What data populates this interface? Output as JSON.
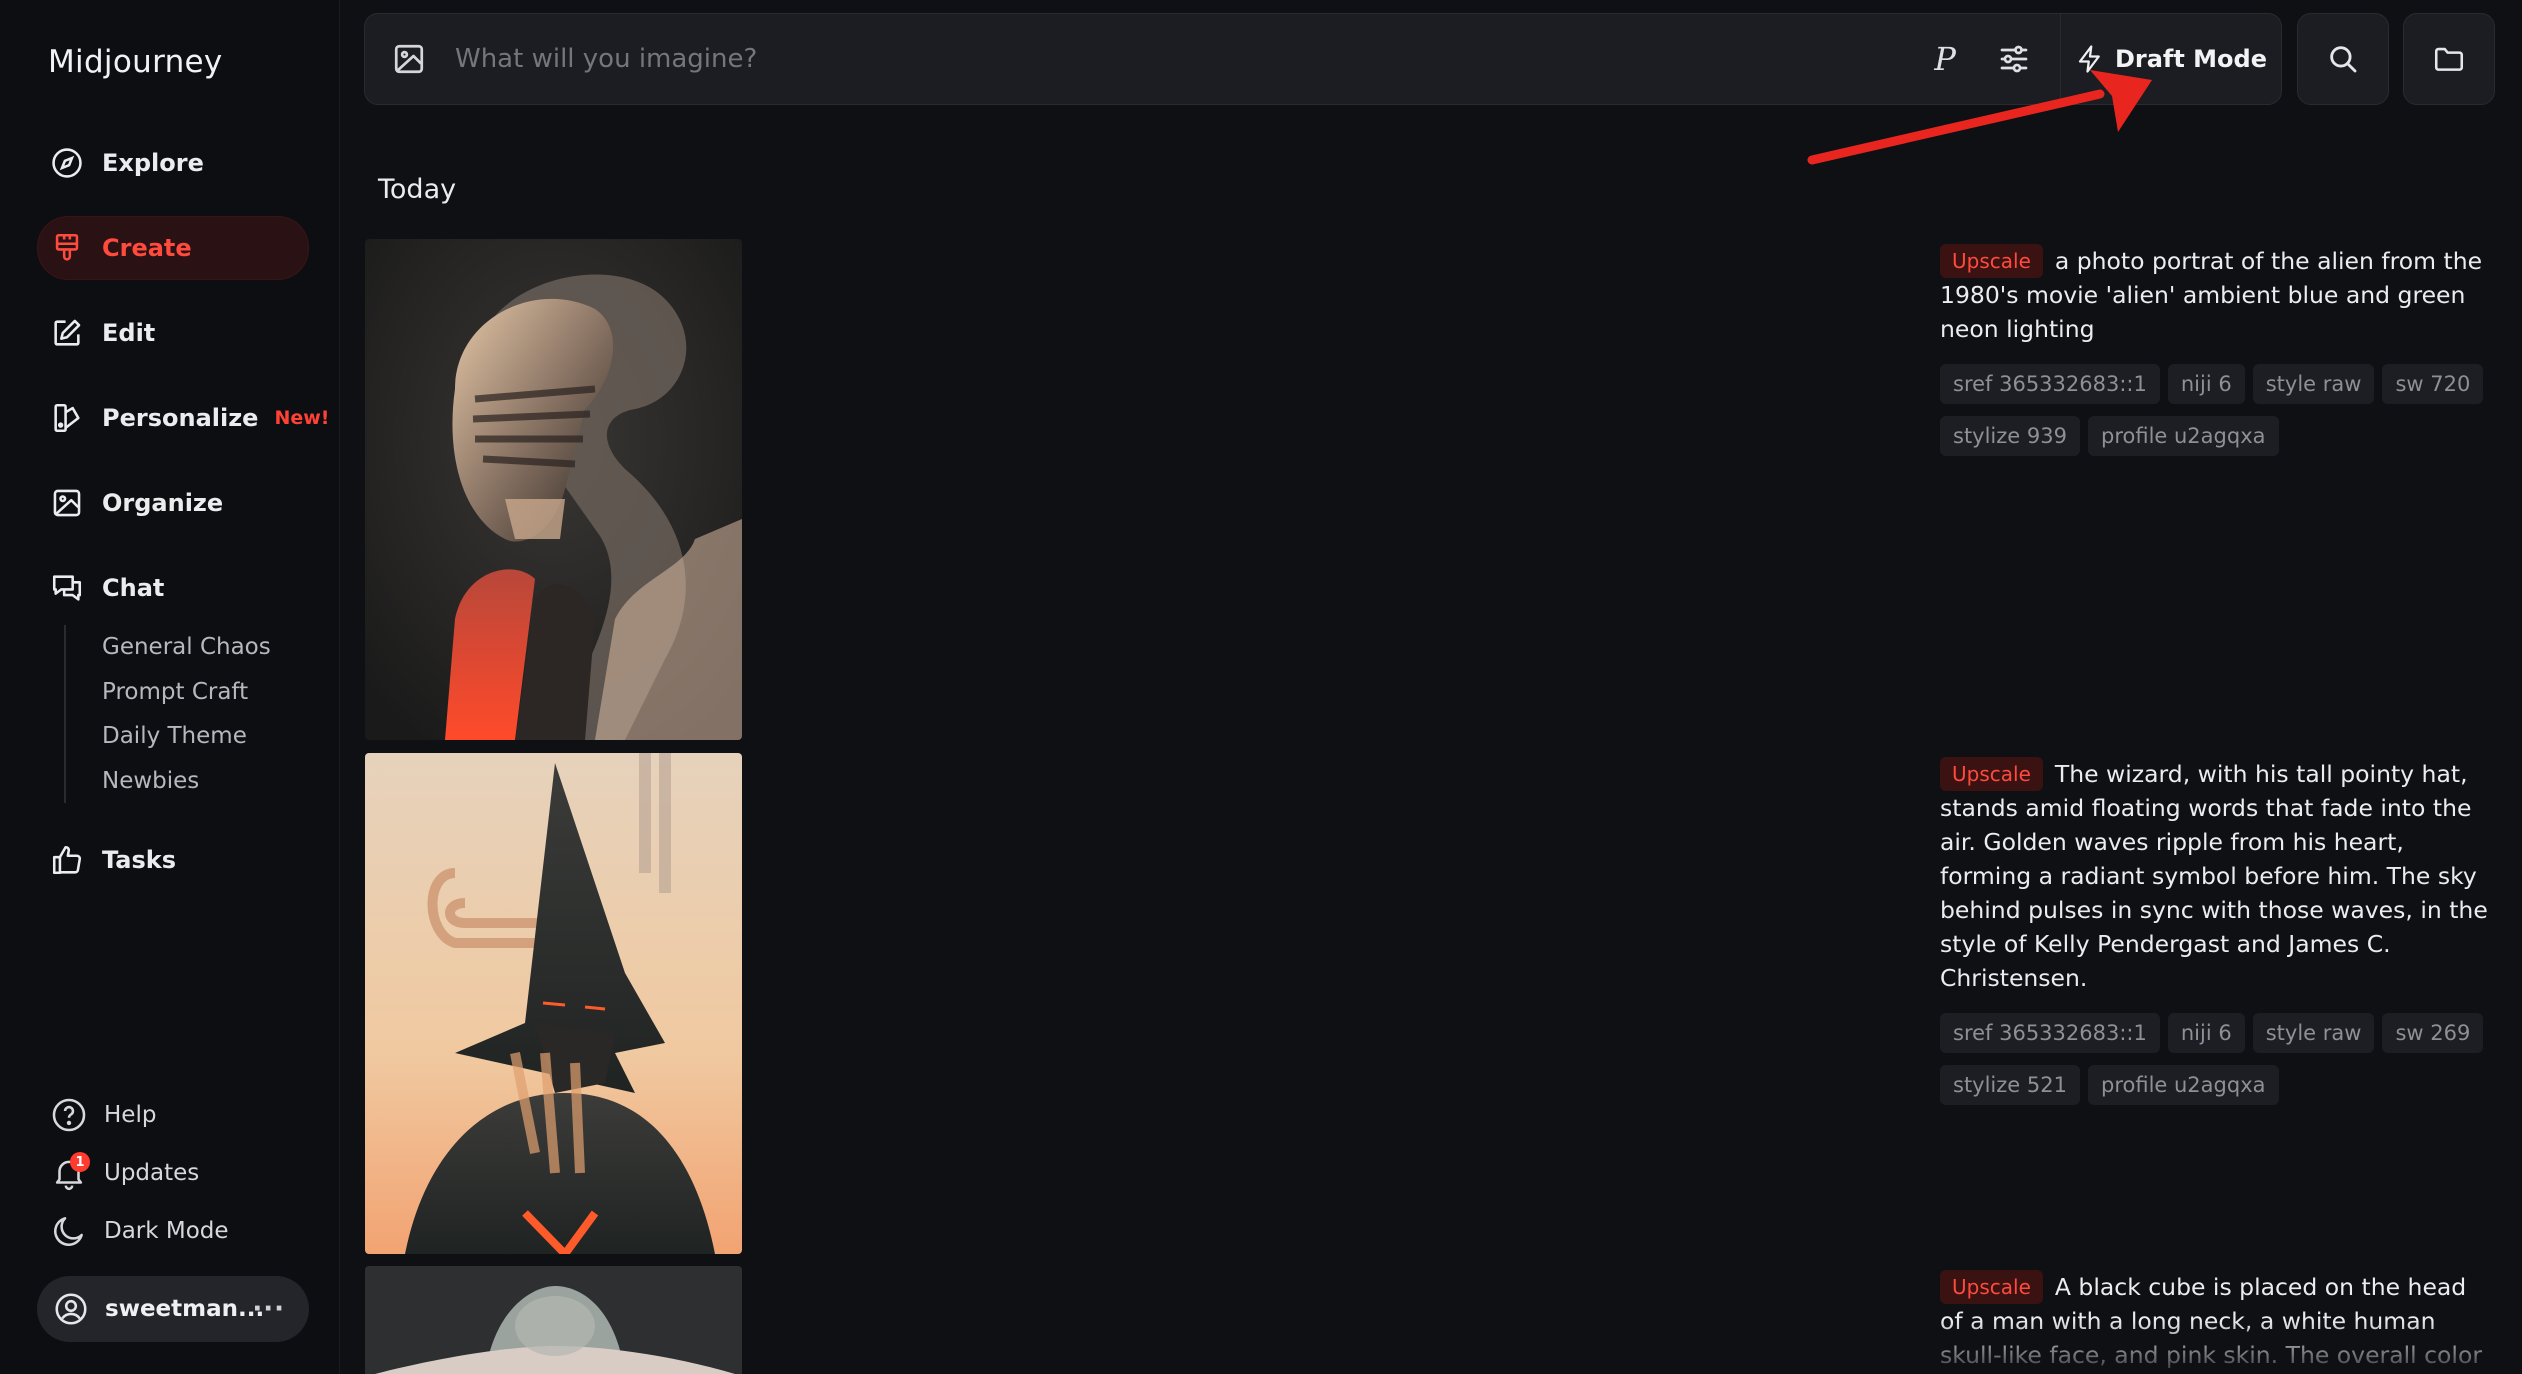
{
  "app": {
    "title": "Midjourney"
  },
  "sidebar": {
    "items": [
      {
        "label": "Explore",
        "icon": "compass-icon"
      },
      {
        "label": "Create",
        "icon": "brush-icon",
        "active": true
      },
      {
        "label": "Edit",
        "icon": "edit-icon"
      },
      {
        "label": "Personalize",
        "icon": "personalize-icon",
        "badge": "New!"
      },
      {
        "label": "Organize",
        "icon": "image-icon"
      },
      {
        "label": "Chat",
        "icon": "chat-icon"
      },
      {
        "label": "Tasks",
        "icon": "thumbs-up-icon"
      }
    ],
    "chat_channels": [
      "General Chaos",
      "Prompt Craft",
      "Daily Theme",
      "Newbies"
    ],
    "bottom": [
      {
        "label": "Help",
        "icon": "help-icon"
      },
      {
        "label": "Updates",
        "icon": "bell-icon",
        "badge": "1"
      },
      {
        "label": "Dark Mode",
        "icon": "moon-icon"
      }
    ],
    "user": {
      "name": "sweetman...",
      "more": "···"
    }
  },
  "prompt_bar": {
    "placeholder": "What will you imagine?",
    "p_label": "P",
    "draft_mode_label": "Draft Mode"
  },
  "main": {
    "section_title": "Today",
    "jobs": [
      {
        "tag": "Upscale",
        "prompt": "a photo portrat of the alien from the 1980's movie 'alien' ambient blue and green neon lighting",
        "params": [
          "sref 365332683::1",
          "niji 6",
          "style raw",
          "sw 720",
          "stylize 939",
          "profile u2agqxa"
        ]
      },
      {
        "tag": "Upscale",
        "prompt": "The wizard, with his tall pointy hat, stands amid floating words that fade into the air. Golden waves ripple from his heart, forming a radiant symbol before him. The sky behind pulses in sync with those waves, in the style of Kelly Pendergast and James C. Christensen.",
        "params": [
          "sref 365332683::1",
          "niji 6",
          "style raw",
          "sw 269",
          "stylize 521",
          "profile u2agqxa"
        ]
      },
      {
        "tag": "Upscale",
        "prompt": "A black cube is placed on the head of a man with a long neck, a white human skull-like face, and pink skin. The overall color scheme",
        "params": []
      }
    ]
  },
  "colors": {
    "accent": "#ff4a3d",
    "background": "#0f1014",
    "panel": "#1c1d22",
    "annotation_arrow": "#e8261f"
  }
}
